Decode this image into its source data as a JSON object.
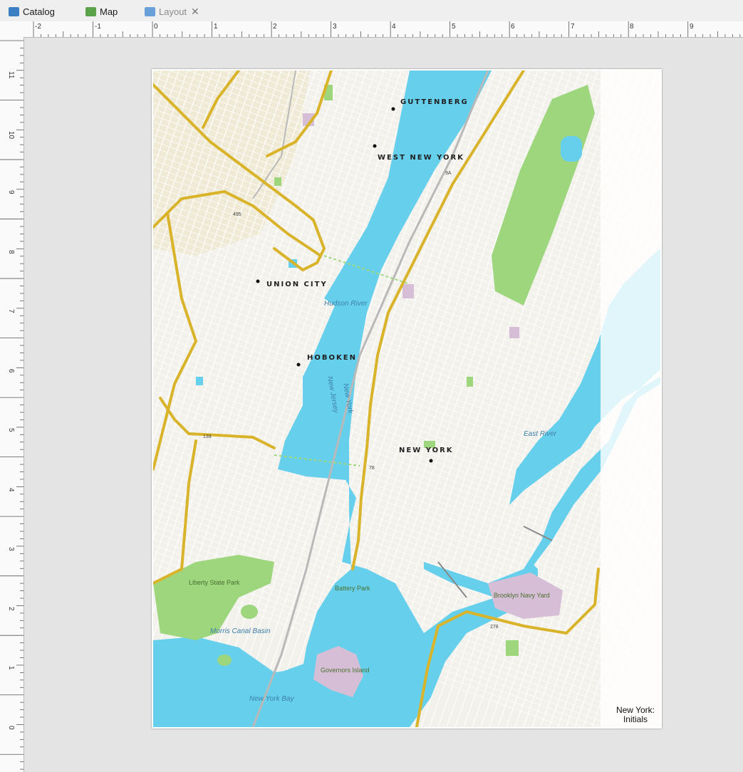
{
  "tabs": [
    {
      "label": "Catalog",
      "icon": "catalog-icon",
      "color": "#3a7fc4"
    },
    {
      "label": "Map",
      "icon": "map-icon",
      "color": "#5aa34a"
    },
    {
      "label": "Layout",
      "icon": "layout-icon",
      "color": "#6aa0d8",
      "active": true,
      "close": "✕"
    }
  ],
  "ruler": {
    "h_labels": [
      "-2",
      "-1",
      "0",
      "1",
      "2",
      "3",
      "4",
      "5",
      "6",
      "7",
      "8",
      "9"
    ],
    "v_labels": [
      "11",
      "10",
      "9",
      "8",
      "7",
      "6",
      "5",
      "4",
      "3",
      "2",
      "1",
      "0"
    ]
  },
  "map": {
    "places": [
      "GUTTENBERG",
      "WEST NEW YORK",
      "UNION CITY",
      "HOBOKEN",
      "NEW YORK"
    ],
    "water_labels": [
      "Hudson River",
      "East River",
      "Morris Canal Basin",
      "New York Bay",
      "New Jersey",
      "New York"
    ],
    "park_labels": [
      "Liberty State Park",
      "Battery Park",
      "Governors Island",
      "Brooklyn Navy Yard"
    ],
    "shields": [
      "495",
      "139",
      "78",
      "278",
      "9A"
    ],
    "caption_line1": "New York:",
    "caption_line2": "Initials",
    "colors": {
      "water": "#66d0ec",
      "land": "#f2f1ec",
      "park": "#9ed67e",
      "highway": "#d9b42b",
      "institution": "#d6bfd6"
    }
  }
}
